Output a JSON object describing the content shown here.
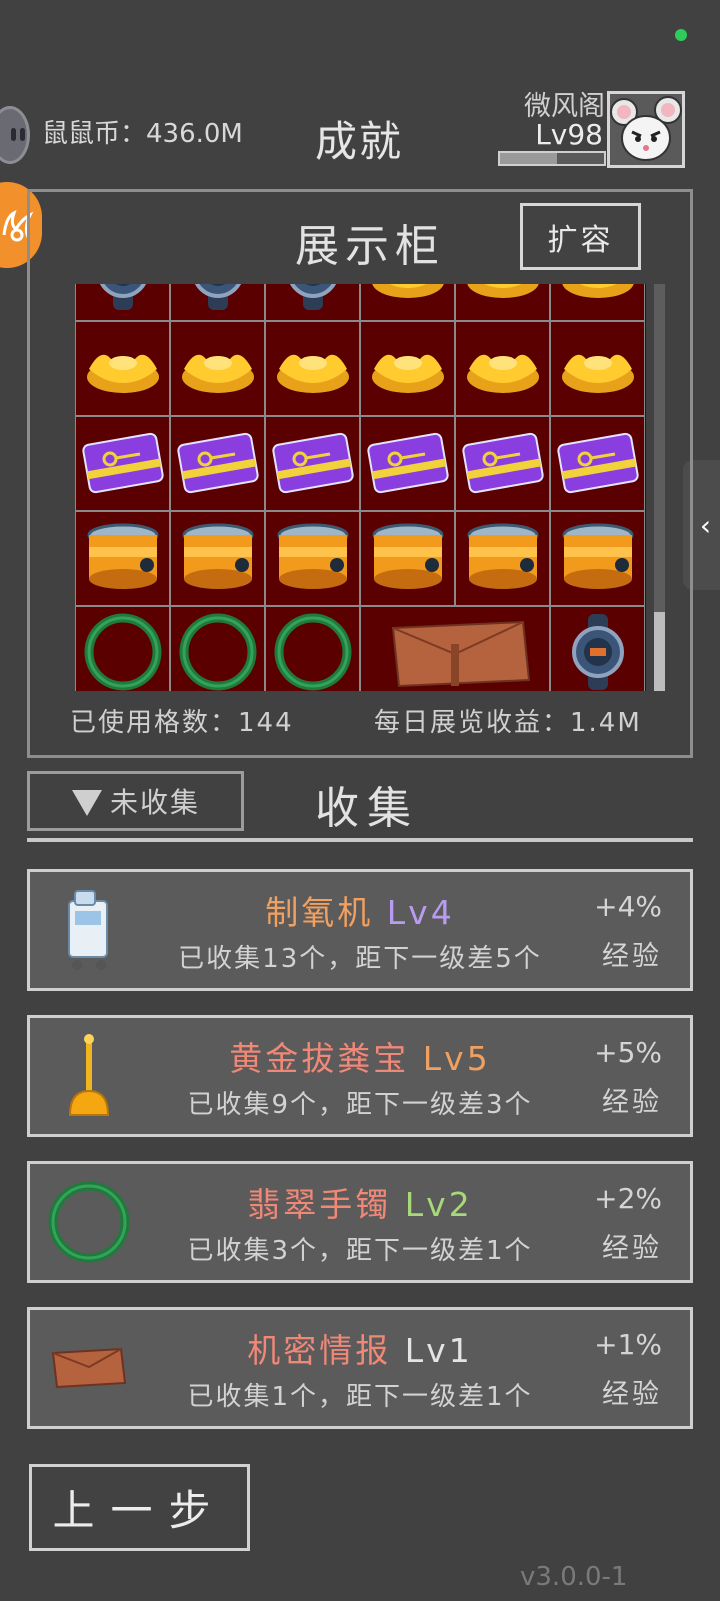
{
  "header": {
    "coin_text": "鼠鼠币：436.0M",
    "title": "成就",
    "player_name": "微风阁",
    "player_level": "Lv98",
    "xp_progress": 0.55
  },
  "showcase": {
    "title": "展示柜",
    "expand_label": "扩容",
    "used_cells": "已使用格数：144",
    "daily_income": "每日展览收益：1.4M",
    "rows": [
      [
        "watch",
        "watch",
        "watch",
        "gold-ingot",
        "gold-ingot",
        "gold-ingot"
      ],
      [
        "gold-ingot",
        "gold-ingot",
        "gold-ingot",
        "gold-ingot",
        "gold-ingot",
        "gold-ingot"
      ],
      [
        "keycard",
        "keycard",
        "keycard",
        "keycard",
        "keycard",
        "keycard"
      ],
      [
        "golden-drum",
        "golden-drum",
        "golden-drum",
        "golden-drum",
        "golden-drum",
        "golden-drum"
      ],
      [
        "jade-bracelet",
        "jade-bracelet",
        "jade-bracelet",
        "leather-folder",
        "leather-folder",
        "watch"
      ]
    ]
  },
  "collection": {
    "filter_label": "未收集",
    "title": "收集",
    "items": [
      {
        "icon": "oxygen-machine-icon",
        "name": "制氧机",
        "level": "Lv4",
        "name_color": "#f0a060",
        "level_color": "#b89cf0",
        "progress": "已收集13个，距下一级差5个",
        "bonus": "+4%",
        "bonus_label": "经验"
      },
      {
        "icon": "golden-plunger-icon",
        "name": "黄金拔粪宝",
        "level": "Lv5",
        "name_color": "#f08878",
        "level_color": "#f0a060",
        "progress": "已收集9个，距下一级差3个",
        "bonus": "+5%",
        "bonus_label": "经验"
      },
      {
        "icon": "jade-bracelet-icon",
        "name": "翡翠手镯",
        "level": "Lv2",
        "name_color": "#f08878",
        "level_color": "#a8d878",
        "progress": "已收集3个，距下一级差1个",
        "bonus": "+2%",
        "bonus_label": "经验"
      },
      {
        "icon": "secret-document-icon",
        "name": "机密情报",
        "level": "Lv1",
        "name_color": "#f08878",
        "level_color": "#e4e4e4",
        "progress": "已收集1个，距下一级差1个",
        "bonus": "+1%",
        "bonus_label": "经验"
      }
    ]
  },
  "footer": {
    "back_label": "上一步",
    "version": "v3.0.0-1"
  }
}
